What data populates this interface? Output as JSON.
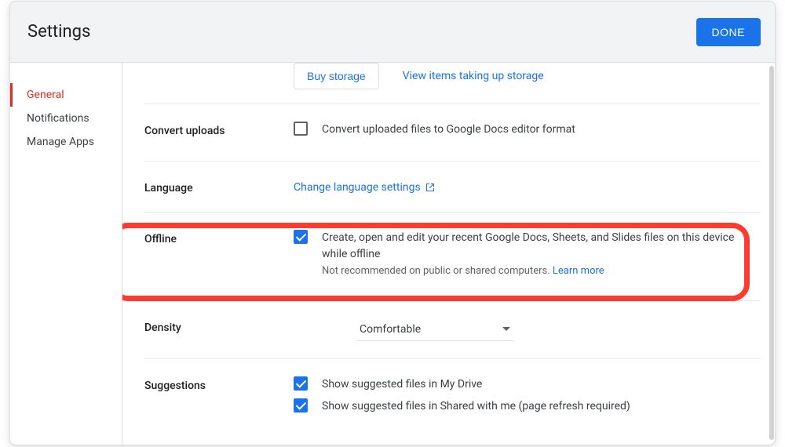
{
  "header": {
    "title": "Settings",
    "done_label": "DONE"
  },
  "sidebar": {
    "items": [
      {
        "label": "General",
        "active": true
      },
      {
        "label": "Notifications",
        "active": false
      },
      {
        "label": "Manage Apps",
        "active": false
      }
    ]
  },
  "storage": {
    "buy_label": "Buy storage",
    "view_link": "View items taking up storage"
  },
  "convert": {
    "title": "Convert uploads",
    "checkbox_label": "Convert uploaded files to Google Docs editor format",
    "checked": false
  },
  "language": {
    "title": "Language",
    "link_label": "Change language settings"
  },
  "offline": {
    "title": "Offline",
    "checked": true,
    "checkbox_label": "Create, open and edit your recent Google Docs, Sheets, and Slides files on this device while offline",
    "hint": "Not recommended on public or shared computers.",
    "learn_more": "Learn more"
  },
  "density": {
    "title": "Density",
    "value": "Comfortable"
  },
  "suggestions": {
    "title": "Suggestions",
    "items": [
      {
        "label": "Show suggested files in My Drive",
        "checked": true
      },
      {
        "label": "Show suggested files in Shared with me (page refresh required)",
        "checked": true
      }
    ]
  }
}
